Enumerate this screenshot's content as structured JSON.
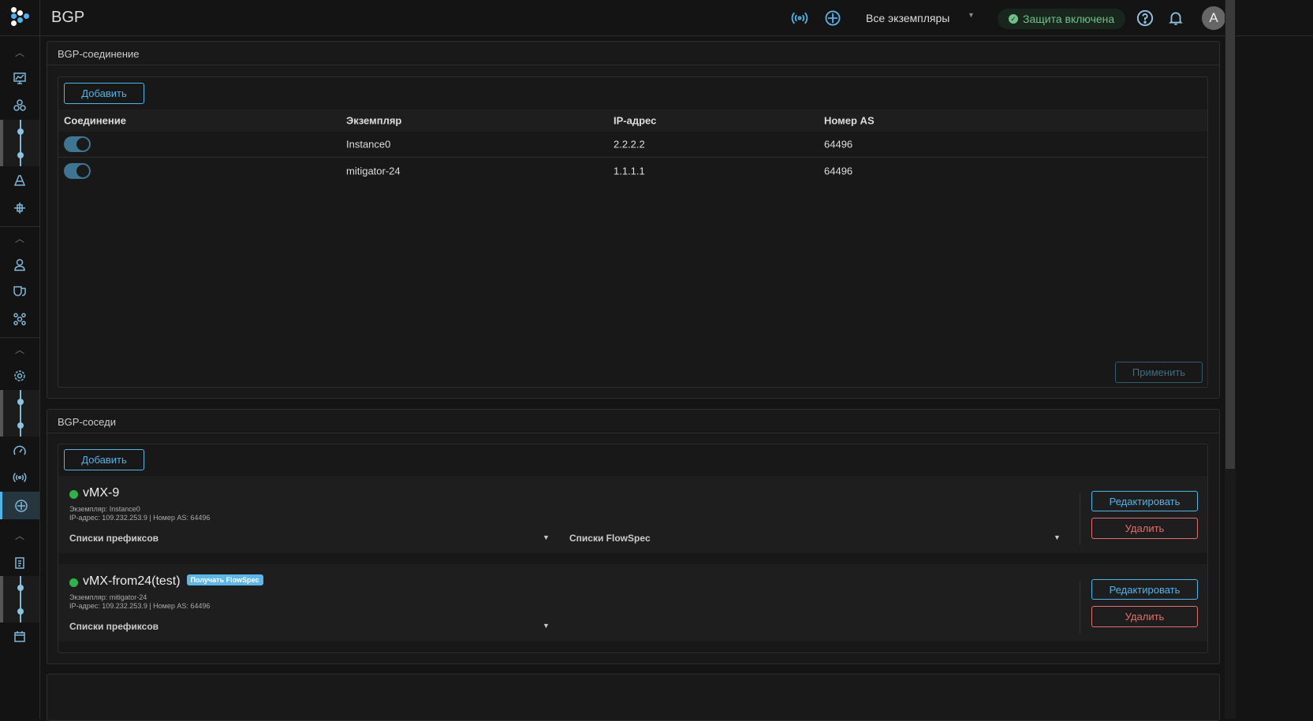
{
  "header": {
    "title": "BGP",
    "instance_select": "Все экземпляры",
    "protection": "Защита включена",
    "avatar": "A"
  },
  "colors": {
    "accent": "#4fb4e8",
    "danger": "#e07070",
    "ok": "#2fb24a"
  },
  "connection": {
    "title": "BGP-соединение",
    "add": "Добавить",
    "apply": "Применить",
    "columns": [
      "Соединение",
      "Экземпляр",
      "IP-адрес",
      "Номер AS"
    ],
    "rows": [
      {
        "enabled": true,
        "instance": "Instance0",
        "ip": "2.2.2.2",
        "as": "64496"
      },
      {
        "enabled": true,
        "instance": "mitigator-24",
        "ip": "1.1.1.1",
        "as": "64496"
      }
    ]
  },
  "neighbors": {
    "title": "BGP-соседи",
    "add": "Добавить",
    "edit": "Редактировать",
    "delete": "Удалить",
    "items": [
      {
        "name": "vMX-9",
        "status": "up",
        "instance": "Экземпляр: Instance0",
        "info": "IP-адрес: 109.232.253.9 | Номер AS: 64496",
        "prefix_lists": "Списки префиксов",
        "flowspec_lists": "Списки FlowSpec"
      },
      {
        "name": "vMX-from24(test)",
        "status": "up",
        "badge": "Получать FlowSpec",
        "instance": "Экземпляр: mitigator-24",
        "info": "IP-адрес: 109.232.253.9 | Номер AS: 64496",
        "prefix_lists": "Списки префиксов"
      }
    ]
  }
}
